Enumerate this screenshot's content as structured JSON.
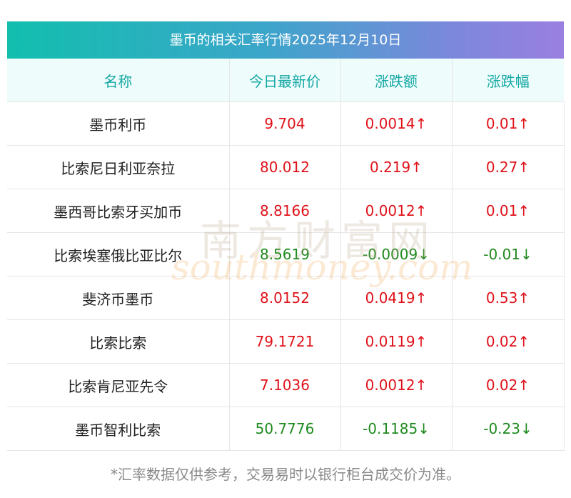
{
  "title": "墨币的相关汇率行情2025年12月10日",
  "headers": [
    "名称",
    "今日最新价",
    "涨跌额",
    "涨跌幅"
  ],
  "rows": [
    {
      "name": "墨币利币",
      "price": "9.704",
      "change": "0.0014↑",
      "pct": "0.01↑",
      "dir": "up"
    },
    {
      "name": "比索尼日利亚奈拉",
      "price": "80.012",
      "change": "0.219↑",
      "pct": "0.27↑",
      "dir": "up"
    },
    {
      "name": "墨西哥比索牙买加币",
      "price": "8.8166",
      "change": "0.0012↑",
      "pct": "0.01↑",
      "dir": "up"
    },
    {
      "name": "比索埃塞俄比亚比尔",
      "price": "8.5619",
      "change": "-0.0009↓",
      "pct": "-0.01↓",
      "dir": "down"
    },
    {
      "name": "斐济币墨币",
      "price": "8.0152",
      "change": "0.0419↑",
      "pct": "0.53↑",
      "dir": "up"
    },
    {
      "name": "比索比索",
      "price": "79.1721",
      "change": "0.0119↑",
      "pct": "0.02↑",
      "dir": "up"
    },
    {
      "name": "比索肯尼亚先令",
      "price": "7.1036",
      "change": "0.0012↑",
      "pct": "0.02↑",
      "dir": "up"
    },
    {
      "name": "墨币智利比索",
      "price": "50.7776",
      "change": "-0.1185↓",
      "pct": "-0.23↓",
      "dir": "down"
    }
  ],
  "footnote": "*汇率数据仅供参考，交易易时以银行柜台成交价为准。",
  "watermark": {
    "cn": "南方财富网",
    "en": "southmoney.com"
  },
  "colors": {
    "up": "#e0121a",
    "down": "#1f8a1f",
    "header_text": "#14a8a3"
  }
}
